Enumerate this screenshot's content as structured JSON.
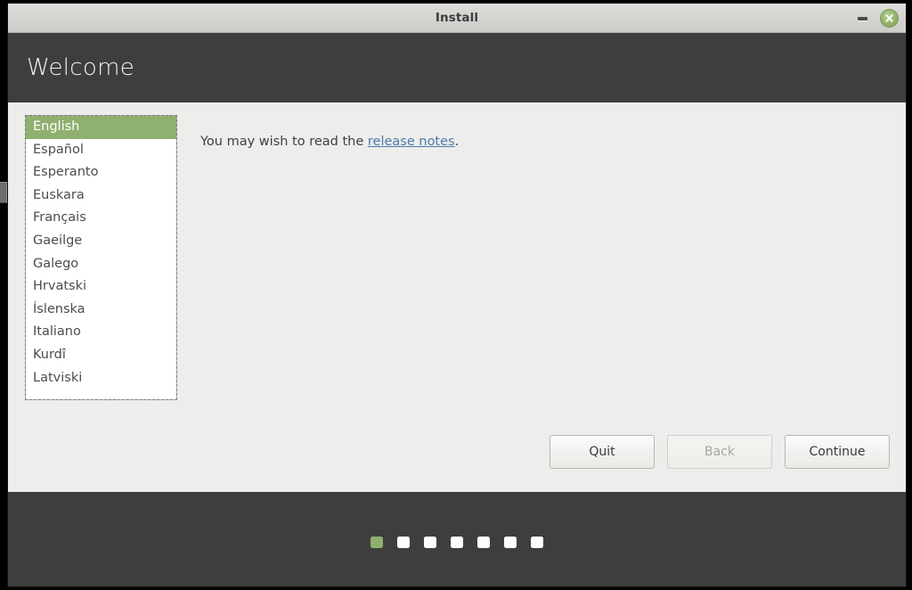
{
  "window": {
    "titlebar": {
      "title": "Install",
      "minimize_icon": "minimize-icon",
      "close_icon": "close-icon"
    },
    "header": {
      "title": "Welcome"
    }
  },
  "language_list": {
    "selected": "English",
    "items": [
      {
        "label": "English",
        "selected": true
      },
      {
        "label": "Español",
        "selected": false
      },
      {
        "label": "Esperanto",
        "selected": false
      },
      {
        "label": "Euskara",
        "selected": false
      },
      {
        "label": "Français",
        "selected": false
      },
      {
        "label": "Gaeilge",
        "selected": false
      },
      {
        "label": "Galego",
        "selected": false
      },
      {
        "label": "Hrvatski",
        "selected": false
      },
      {
        "label": "Íslenska",
        "selected": false
      },
      {
        "label": "Italiano",
        "selected": false
      },
      {
        "label": "Kurdî",
        "selected": false
      },
      {
        "label": "Latviski",
        "selected": false
      }
    ]
  },
  "info": {
    "text_before": "You may wish to read the ",
    "link_label": "release notes",
    "text_after": "."
  },
  "actions": {
    "quit_label": "Quit",
    "back_label": "Back",
    "continue_label": "Continue",
    "back_disabled": true
  },
  "footer": {
    "steps": [
      {
        "active": true
      },
      {
        "active": false
      },
      {
        "active": false
      },
      {
        "active": false
      },
      {
        "active": false
      },
      {
        "active": false
      },
      {
        "active": false
      }
    ],
    "step_count": 7,
    "current_step": 1
  },
  "colors": {
    "accent_green": "#8fb06e",
    "header_dark": "#403e3c",
    "content_bg": "#ededeb",
    "link_blue": "#4b7cae",
    "titlebar_bg": "#d4d3d0"
  }
}
